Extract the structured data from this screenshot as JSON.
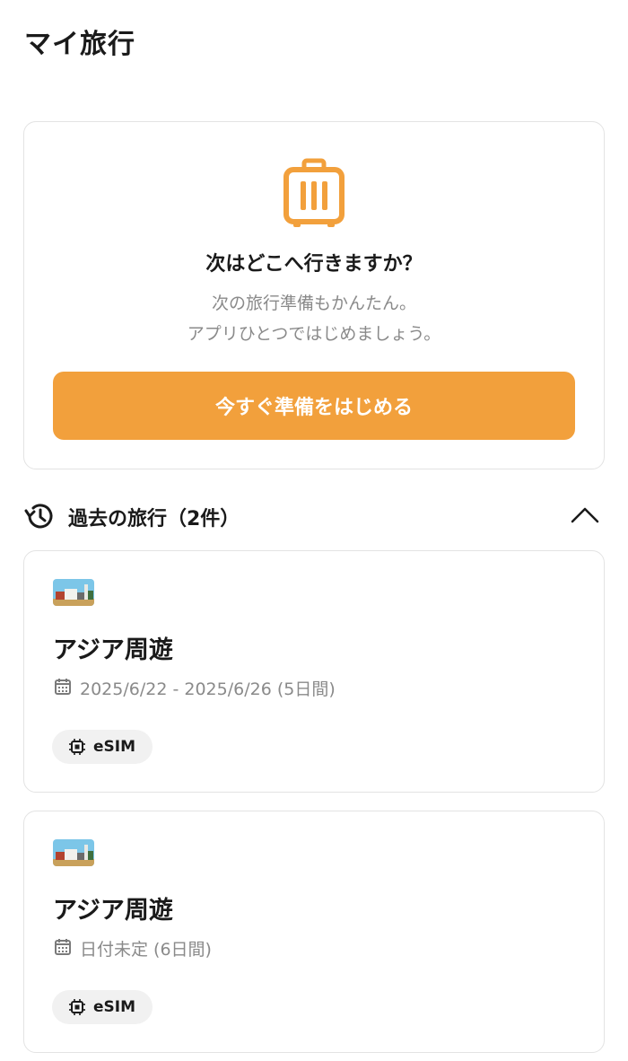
{
  "header": {
    "title": "マイ旅行"
  },
  "promo": {
    "icon": "suitcase-icon",
    "heading": "次はどこへ行きますか？",
    "subtext_line1": "次の旅行準備もかんたん。",
    "subtext_line2": "アプリひとつではじめましょう。",
    "button_label": "今すぐ準備をはじめる",
    "accent_color": "#f2a03c"
  },
  "past_trips": {
    "title": "過去の旅行（2件）",
    "icon": "history-icon",
    "toggle_icon": "chevron-up-icon",
    "trips": [
      {
        "title": "アジア周遊",
        "dates": "2025/6/22 - 2025/6/26 (5日間)",
        "tag": "eSIM"
      },
      {
        "title": "アジア周遊",
        "dates": "日付未定 (6日間)",
        "tag": "eSIM"
      }
    ]
  }
}
